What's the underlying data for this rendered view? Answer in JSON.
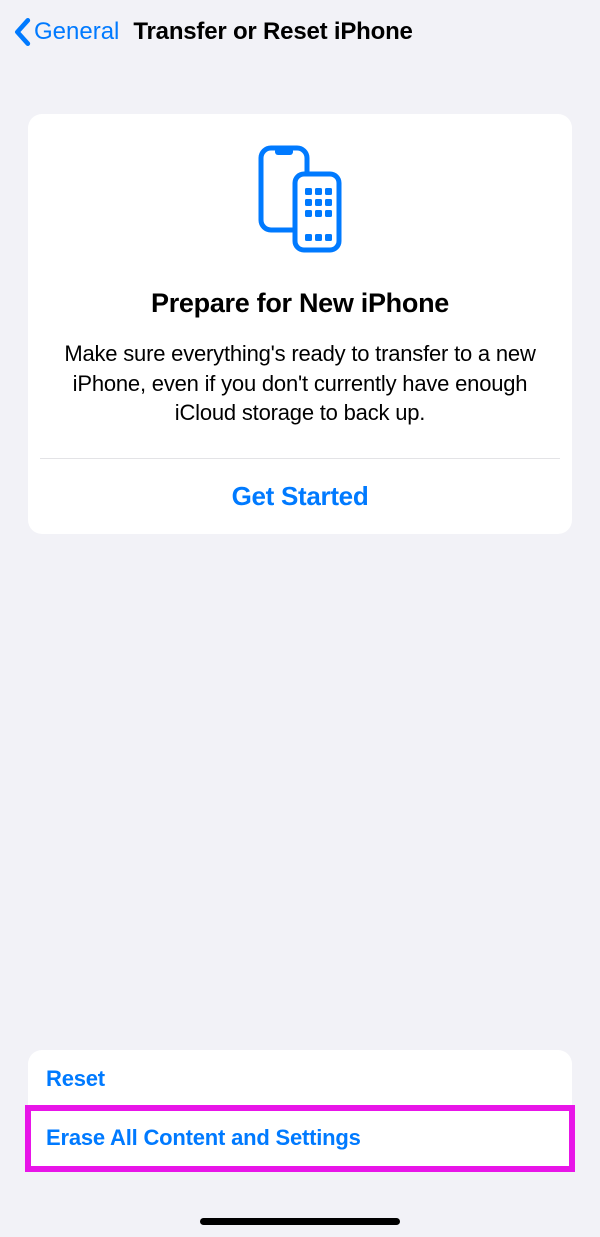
{
  "nav": {
    "back_label": "General",
    "title": "Transfer or Reset iPhone"
  },
  "prepare_card": {
    "title": "Prepare for New iPhone",
    "description": "Make sure everything's ready to transfer to a new iPhone, even if you don't currently have enough iCloud storage to back up.",
    "action_label": "Get Started"
  },
  "bottom_list": {
    "reset_label": "Reset",
    "erase_label": "Erase All Content and Settings"
  },
  "colors": {
    "ios_blue": "#007aff",
    "highlight_magenta": "#e815e8",
    "background": "#f2f2f7"
  }
}
